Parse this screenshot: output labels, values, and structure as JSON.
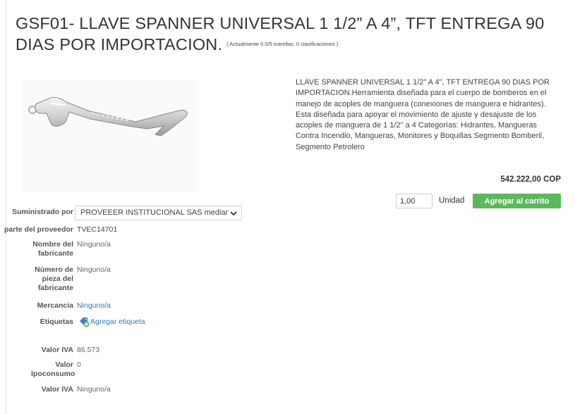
{
  "product": {
    "title": "GSF01- LLAVE SPANNER UNIVERSAL 1 1/2” A 4”, TFT ENTREGA 90 DIAS POR IMPORTACION.",
    "rating_text": "( Actualmente 0.0/5 estrellas. 0 clasificaciones )",
    "image_alt": "Llave spanner universal",
    "description": "LLAVE SPANNER UNIVERSAL 1 1/2\" A 4\", TFT ENTREGA 90 DIAS POR IMPORTACION.Herramienta diseñada para el cuerpo de bomberos en el manejo de acoples de manguera (conexiones de manguera e hidrantes). Esta diseñada para apoyar el movimiento de ajuste y desajuste de los acoples de manguera de 1 1/2\" a 4 Categorías: Hidrantes, Mangueras Contra Incendio, Mangueras, Monitores y Boquillas Segmento Bomberil, Segmento Petrolero",
    "price": "542.222,00 COP"
  },
  "cart": {
    "quantity": "1,00",
    "unit_label": "Unidad",
    "add_button": "Agregar al carrito"
  },
  "details": {
    "supplied_by_label": "Suministrado por",
    "supplied_by_value": "PROVEEER INSTITUCIONAL SAS mediante",
    "supplier_part_label": "parte del proveedor",
    "supplier_part_value": "TVEC14701",
    "manufacturer_name_label": "Nombre del fabricante",
    "manufacturer_name_value": "Ninguno/a",
    "manufacturer_part_label": "Número de pieza del fabricante",
    "manufacturer_part_value": "Ninguno/a",
    "merchandise_label": "Mercancia",
    "merchandise_value": "Ninguno/a",
    "tags_label": "Etiquetas",
    "add_tag_link": "Agregar etiqueta",
    "iva_label": "Valor IVA",
    "iva_value": "86.573",
    "ipoconsumo_label": "Valor Ipoconsumo",
    "ipoconsumo_value": "0",
    "iva2_label": "Valor IVA",
    "iva2_value": "Ninguno/a"
  },
  "icons": {
    "tag": "tag-add-icon",
    "dropdown": "chevron-down-icon"
  },
  "colors": {
    "accent_green": "#5cb85c",
    "link_blue": "#2a7ab8"
  }
}
